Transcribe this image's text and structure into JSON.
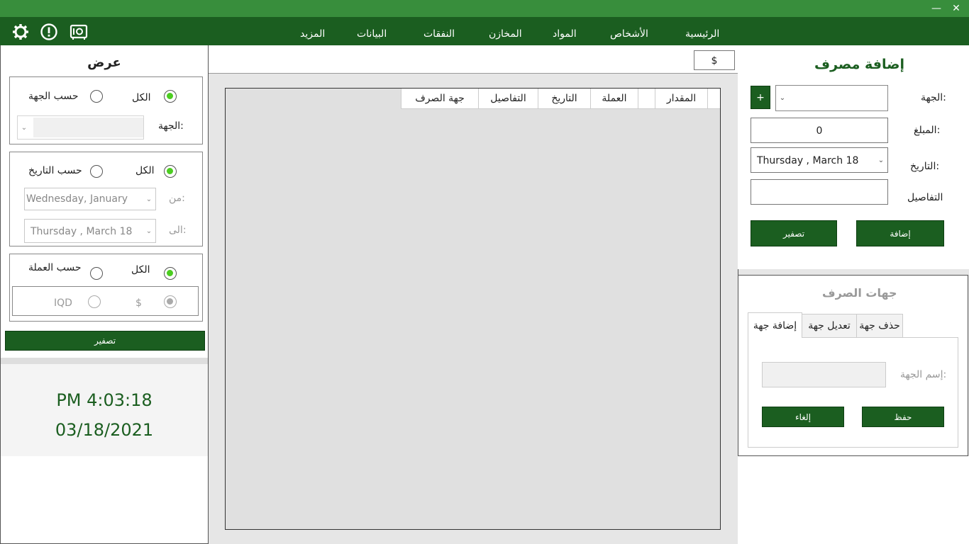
{
  "window": {
    "minimize_glyph": "—",
    "close_glyph": "✕",
    "titlebar_color": "#388e3c",
    "menubar_color": "#1b5e20"
  },
  "menu": {
    "items": [
      "الرئيسية",
      "الأشخاص",
      "المواد",
      "المخازن",
      "النفقات",
      "البيانات",
      "المزيد"
    ],
    "icons": [
      "gear-icon",
      "alert-icon",
      "safe-icon"
    ]
  },
  "filter": {
    "title": "عرض",
    "by_party": {
      "all_label": "الكل",
      "by_label": "حسب الجهة",
      "party_label": "الجهة:"
    },
    "by_date": {
      "all_label": "الكل",
      "by_label": "حسب التاريخ",
      "from_label": "من:",
      "from_value": "Wednesday,   January",
      "to_label": "الى:",
      "to_value": "Thursday  ,    March     18"
    },
    "by_currency": {
      "all_label": "الكل",
      "by_label": "حسب العملة",
      "iqd_label": "IQD",
      "usd_label": "$"
    },
    "reset_label": "تصفير"
  },
  "clock": {
    "time": "PM 4:03:18",
    "date": "03/18/2021"
  },
  "center": {
    "currency_symbol": "$",
    "columns": [
      "المقدار",
      "العملة",
      "التاريخ",
      "التفاصيل",
      "جهة الصرف"
    ]
  },
  "add_expense": {
    "title": "إضافة مصرف",
    "party_label": "الجهة:",
    "add_party_button": "+",
    "amount_label": "المبلغ:",
    "amount_value": "0",
    "date_label": "التاريخ:",
    "date_value": "Thursday  ,    March     18",
    "details_label": "التفاصيل",
    "add_button": "إضافة",
    "reset_button": "تصفير"
  },
  "destinations": {
    "title": "جهات الصرف",
    "tabs": [
      "إضافة جهة",
      "تعديل جهة",
      "حذف جهة"
    ],
    "name_label": "إسم الجهة:",
    "save_button": "حفظ",
    "cancel_button": "إلغاء"
  },
  "colors": {
    "brand_green": "#1b5e20",
    "accent_green": "#4ccd21",
    "panel_gray": "#e6e6e6"
  }
}
